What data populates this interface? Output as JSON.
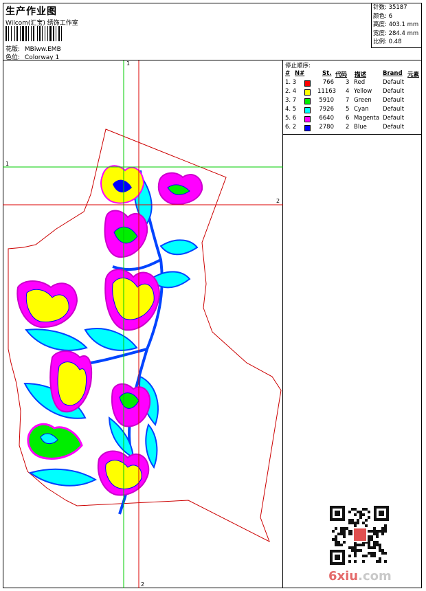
{
  "header": {
    "title": "生产作业图",
    "company": "Wilcom(汇宝) 绣饰工作室",
    "design_label": "花版:",
    "design_value": "MBiww.EMB",
    "colorway_label": "色位:",
    "colorway_value": "Colorway 1"
  },
  "stats": {
    "stitches": "针数: 35187",
    "colors": "颜色: 6",
    "height": "高度: 403.1 mm",
    "width": "宽度: 284.4 mm",
    "scale": "比例: 0.48"
  },
  "stop_panel": {
    "title": "停止顺序:",
    "columns": [
      "#",
      "N#",
      "St.",
      "代码",
      "描述",
      "Brand",
      "元素"
    ],
    "rows": [
      {
        "num": "1. 3",
        "stitches": "766",
        "code": "3",
        "desc": "Red",
        "brand": "Default",
        "color": "#ff0000"
      },
      {
        "num": "2. 4",
        "stitches": "11163",
        "code": "4",
        "desc": "Yellow",
        "brand": "Default",
        "color": "#ffff00"
      },
      {
        "num": "3. 7",
        "stitches": "5910",
        "code": "7",
        "desc": "Green",
        "brand": "Default",
        "color": "#00ee00"
      },
      {
        "num": "4. 5",
        "stitches": "7926",
        "code": "5",
        "desc": "Cyan",
        "brand": "Default",
        "color": "#00ffff"
      },
      {
        "num": "5. 6",
        "stitches": "6640",
        "code": "6",
        "desc": "Magenta",
        "brand": "Default",
        "color": "#ff00ff"
      },
      {
        "num": "6. 2",
        "stitches": "2780",
        "code": "2",
        "desc": "Blue",
        "brand": "Default",
        "color": "#0000ff"
      }
    ]
  },
  "guides": {
    "green_v": "1",
    "green_h": "1",
    "red_h": "2",
    "red_v": "2"
  },
  "watermark": {
    "brand": "6xiu",
    "suffix": ".com"
  },
  "colors": {
    "red": "#ff0000",
    "yellow": "#ffff00",
    "green": "#00ee00",
    "cyan": "#00ffff",
    "magenta": "#ff00ff",
    "blue": "#0000ff",
    "guide_green": "#00cc00",
    "guide_red": "#dd0000",
    "outline": "#cc0000"
  }
}
